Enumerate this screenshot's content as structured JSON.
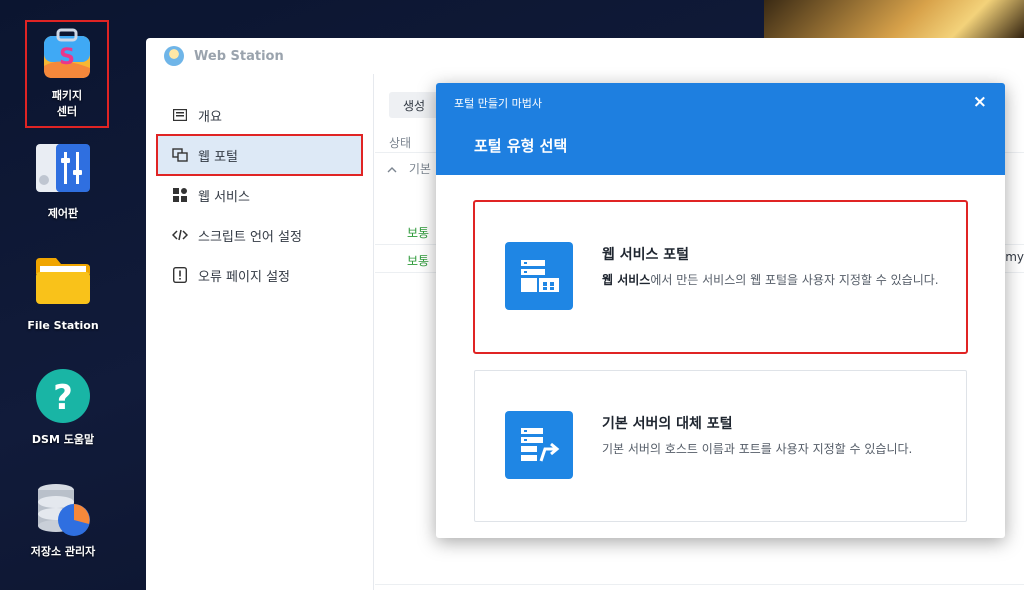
{
  "desktop": {
    "icons": [
      {
        "label_line1": "패키지",
        "label_line2": "센터",
        "icon": "package-center-icon"
      },
      {
        "label": "제어판",
        "icon": "control-panel-icon"
      },
      {
        "label": "File Station",
        "icon": "folder-icon"
      },
      {
        "label": "DSM 도움말",
        "icon": "help-icon"
      },
      {
        "label": "저장소 관리자",
        "icon": "storage-manager-icon"
      }
    ]
  },
  "window": {
    "title": "Web Station",
    "sidebar": [
      {
        "label": "개요",
        "icon": "overview-icon"
      },
      {
        "label": "웹 포털",
        "icon": "web-portal-icon"
      },
      {
        "label": "웹 서비스",
        "icon": "web-service-icon"
      },
      {
        "label": "스크립트 언어 설정",
        "icon": "code-icon"
      },
      {
        "label": "오류 페이지 설정",
        "icon": "error-page-icon"
      }
    ],
    "main": {
      "create_label": "생성",
      "col_status": "상태",
      "group_label": "기본",
      "rows": [
        "보통",
        "보통"
      ],
      "cut_text": "omy"
    }
  },
  "wizard": {
    "header_small": "포털 만들기 마법사",
    "close": "×",
    "title": "포털 유형 선택",
    "options": [
      {
        "title": "웹 서비스 포털",
        "desc_bold": "웹 서비스",
        "desc_rest": "에서 만든 서비스의 웹 포털을 사용자 지정할 수 있습니다.",
        "icon": "web-service-portal-icon"
      },
      {
        "title": "기본 서버의 대체 포털",
        "desc": "기본 서버의 호스트 이름과 포트를 사용자 지정할 수 있습니다.",
        "icon": "alias-portal-icon"
      }
    ]
  },
  "colors": {
    "accent": "#1e7fe0",
    "highlight": "#e02424",
    "status_normal": "#2e9a3a"
  }
}
